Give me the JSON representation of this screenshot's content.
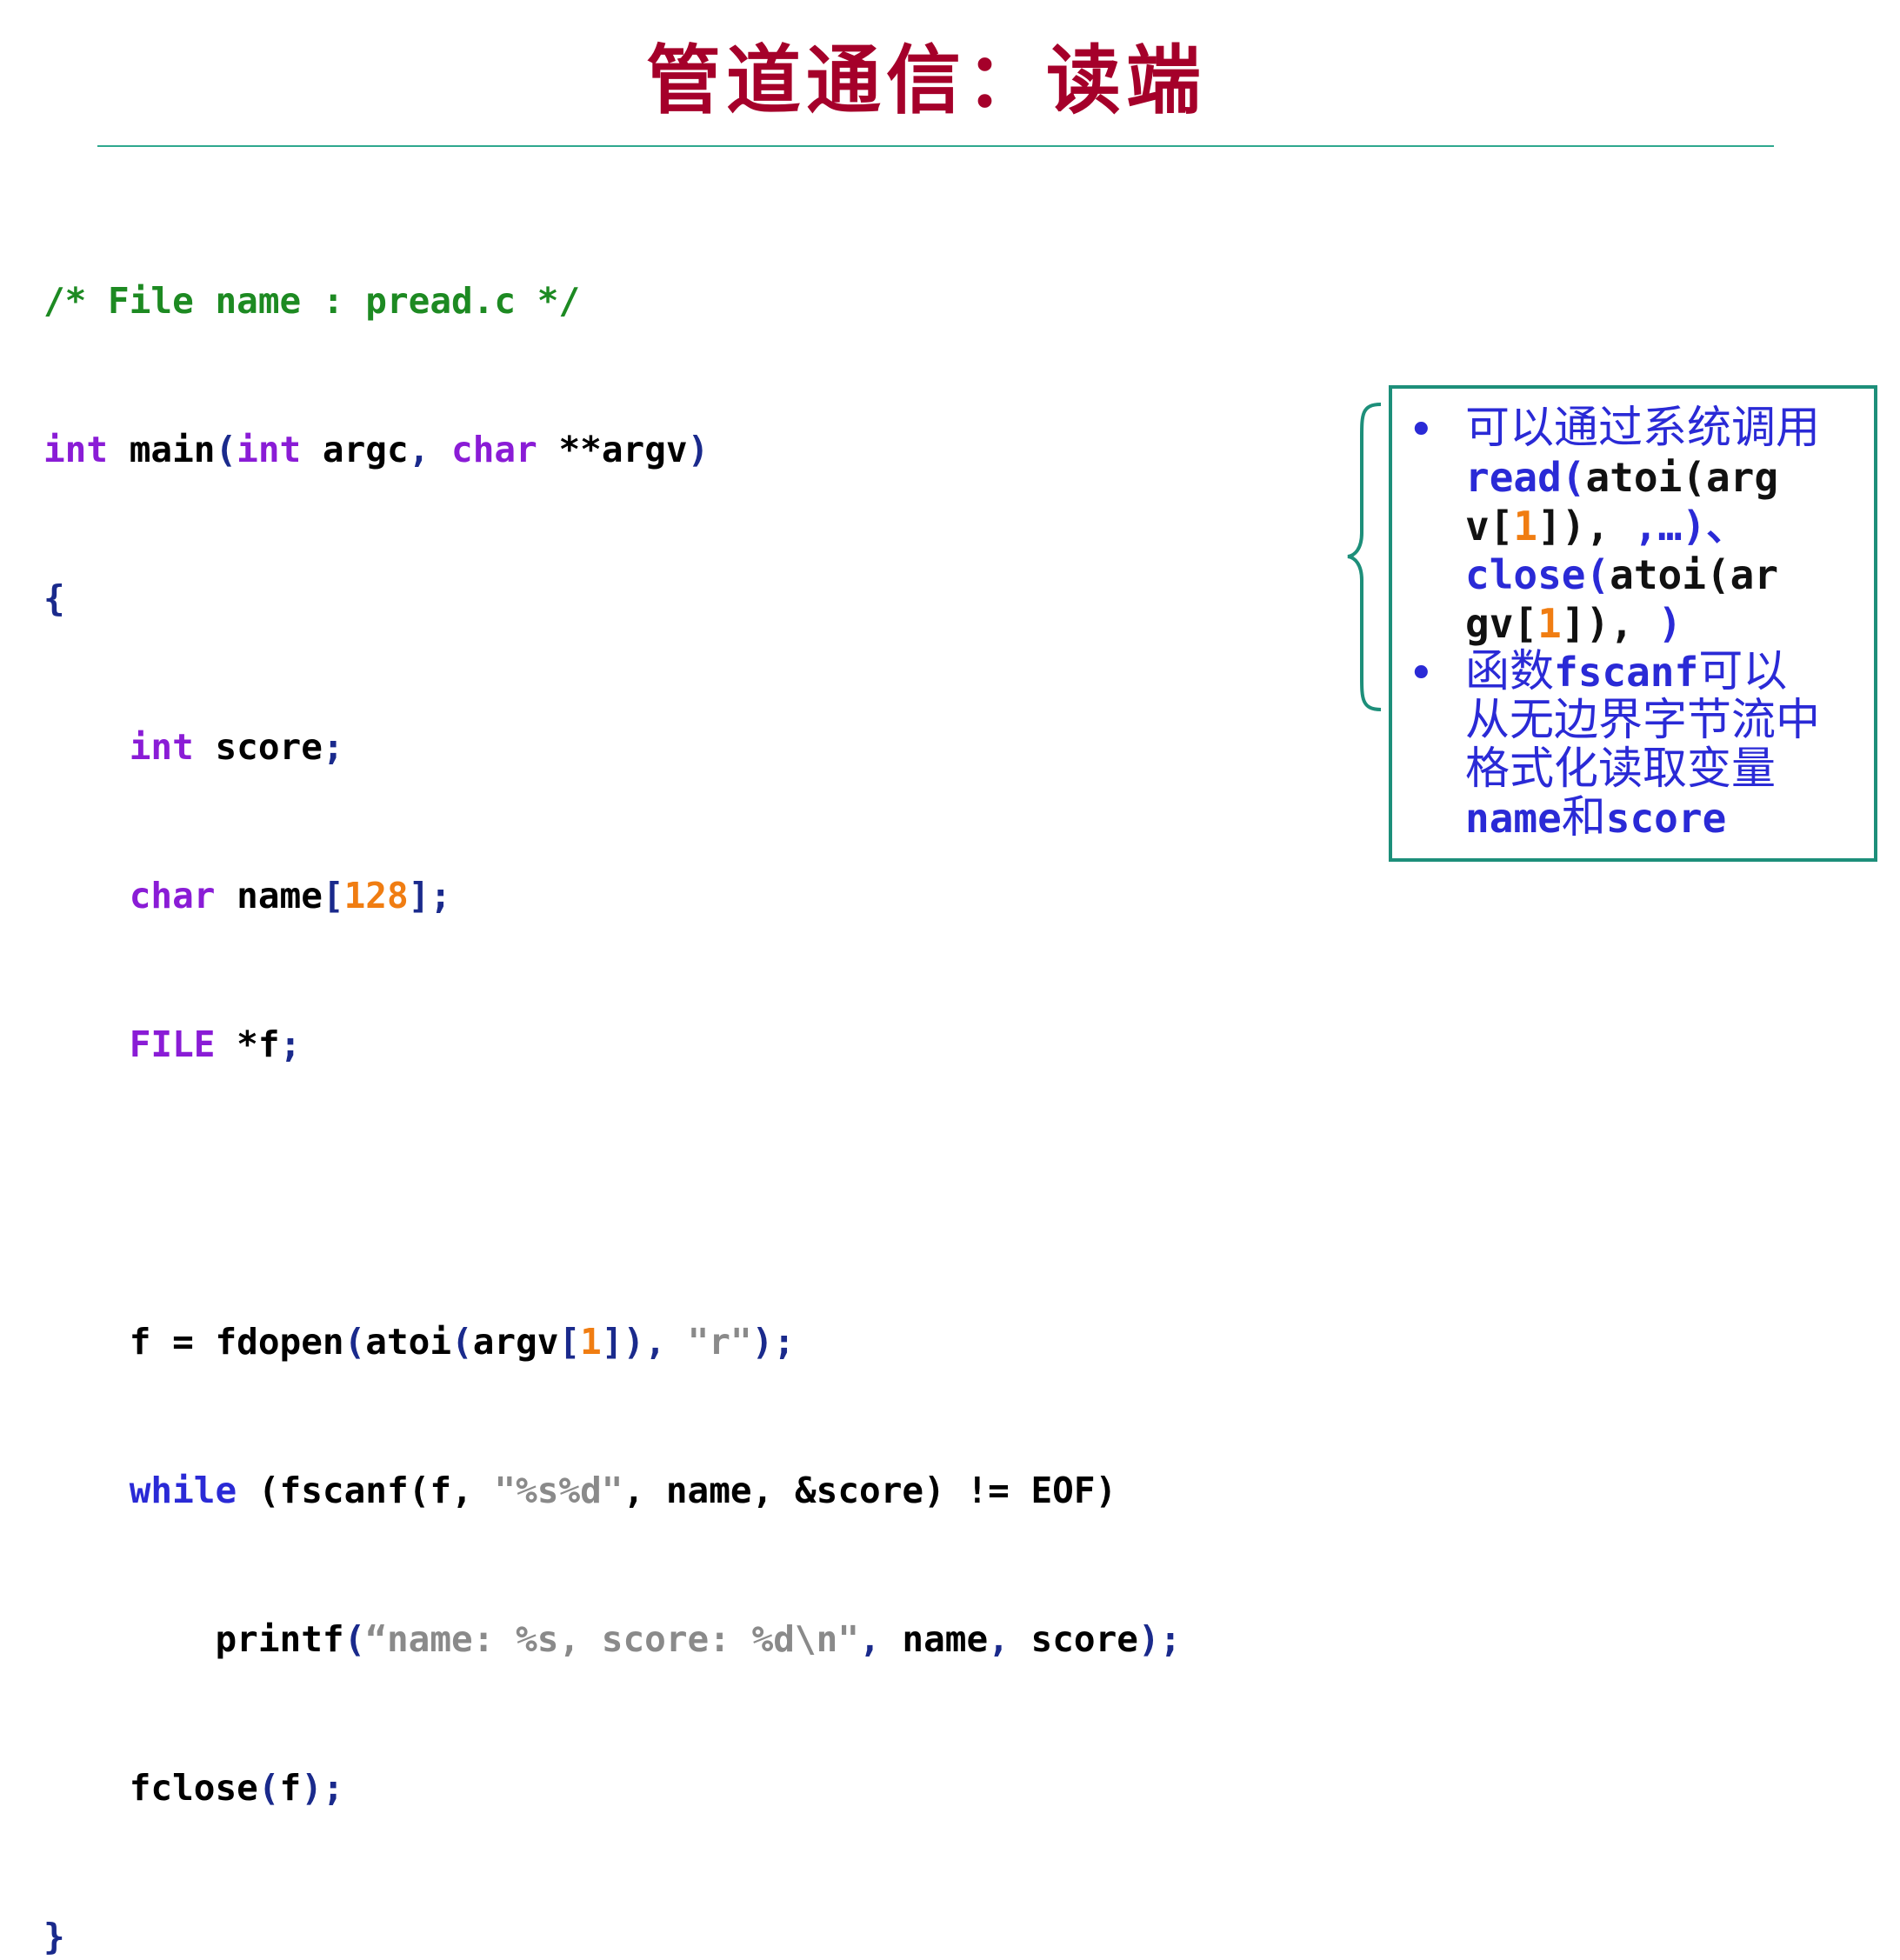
{
  "title": "管道通信：读端",
  "code": {
    "l1": "/* File name : pread.c */",
    "l2": {
      "kw1": "int",
      "t1": " main",
      "p1": "(",
      "kw2": "int",
      "t2": " argc",
      "p2": ", ",
      "kw3": "char",
      "t3": " **argv",
      "p3": ")"
    },
    "l3": "{",
    "l4": {
      "indent": "    ",
      "kw": "int",
      "t": " score",
      "p": ";"
    },
    "l5": {
      "indent": "    ",
      "kw": "char",
      "t": " name",
      "p1": "[",
      "n": "128",
      "p2": "];"
    },
    "l6": {
      "indent": "    ",
      "kw": "FILE",
      "t": " *f",
      "p": ";"
    },
    "l8": {
      "indent": "    ",
      "t1": "f = fdopen",
      "p1": "(",
      "t2": "atoi",
      "p2": "(",
      "t3": "argv",
      "p3": "[",
      "n": "1",
      "p4": "]), ",
      "s": "\"r\"",
      "p5": ");"
    },
    "l9": {
      "indent": "    ",
      "kw": "while",
      "t1": " (fscanf(f, ",
      "s": "\"%s%d\"",
      "t2": ", name, &score) != EOF)"
    },
    "l10": {
      "indent": "        ",
      "t1": "printf",
      "p1": "(",
      "s": "“name: %s, score: %d\\n\"",
      "p2": ", ",
      "t2": "name",
      "p3": ", ",
      "t3": "score",
      "p4": ");"
    },
    "l11": {
      "indent": "    ",
      "t": "fclose",
      "p1": "(",
      "t2": "f",
      "p2": ");"
    },
    "l12": "}"
  },
  "note": {
    "bullet": "•",
    "item1": {
      "a": "可以通过系统调用",
      "b_kw": "read(",
      "b_txt": "atoi(arg",
      "c1": "v[",
      "c_num": "1",
      "c2": "]), ",
      "c3": ",…)、",
      "d_kw": "close(",
      "d_txt": "atoi(ar",
      "e1": "gv[",
      "e_num": "1",
      "e2": "]), ",
      "e3": ")"
    },
    "item2": {
      "a": "函数",
      "a_kw": "fscanf",
      "a2": "可以",
      "b": "从无边界字节流中",
      "c": "格式化读取变量",
      "d_kw1": "name",
      "d_mid": "和",
      "d_kw2": "score"
    }
  },
  "colors": {
    "title": "#a5002a",
    "rule": "#2ea88e",
    "comment": "#1d8a22",
    "keyword_purple": "#8a1cd6",
    "keyword_blue": "#2a2ad6",
    "number": "#f07d12",
    "string": "#8a8a8a",
    "note_border": "#1d8f7a"
  }
}
